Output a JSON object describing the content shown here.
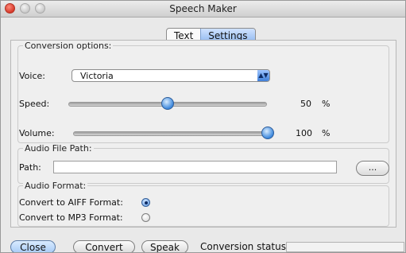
{
  "window": {
    "title": "Speech Maker"
  },
  "tabs": [
    {
      "label": "Text",
      "active": false
    },
    {
      "label": "Settings",
      "active": true
    }
  ],
  "conversion": {
    "group_label": "Conversion options:",
    "voice_label": "Voice:",
    "voice_value": "Victoria",
    "speed_label": "Speed:",
    "speed_value": "50",
    "speed_unit": "%",
    "speed_fraction": 0.5,
    "volume_label": "Volume:",
    "volume_value": "100",
    "volume_unit": "%",
    "volume_fraction": 1.0
  },
  "audio_file": {
    "group_label": "Audio File Path:",
    "path_label": "Path:",
    "path_value": "",
    "browse_label": "..."
  },
  "audio_format": {
    "group_label": "Audio Format:",
    "aiff_label": "Convert to AIFF Format:",
    "aiff_selected": true,
    "mp3_label": "Convert to MP3 Format:",
    "mp3_selected": false
  },
  "buttons": {
    "close": "Close",
    "convert": "Convert",
    "speak": "Speak"
  },
  "status": {
    "label": "Conversion status:"
  },
  "colors": {
    "accent": "#3d88dc"
  }
}
